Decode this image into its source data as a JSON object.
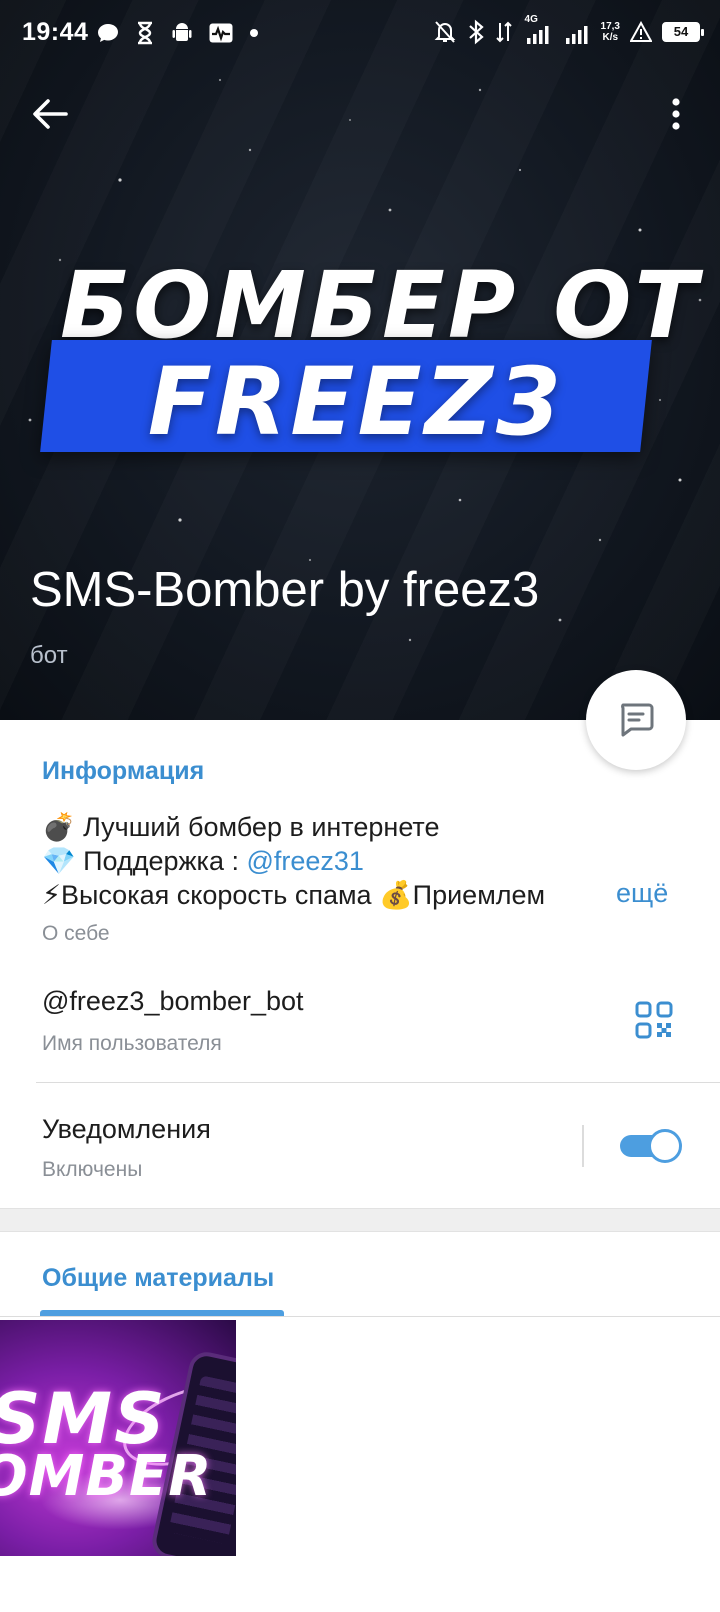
{
  "status_bar": {
    "time": "19:44",
    "network_label": "4G",
    "speed_value": "17,3",
    "speed_unit": "K/s",
    "battery": "54"
  },
  "header": {
    "banner_line1": "БОМБЕР ОТ",
    "banner_line2": "FREEZ3",
    "name": "SMS-Bomber by freez3",
    "subtitle": "бот"
  },
  "info": {
    "section_title": "Информация",
    "bio_line1": "💣 Лучший бомбер в интернете",
    "bio_line2_prefix": "💎 Поддержка : ",
    "bio_line2_link": "@freez31",
    "bio_line3": "⚡Высокая скорость спама 💰Приемлем",
    "more_label": "ещё",
    "about_label": "О себе",
    "username": "@freez3_bomber_bot",
    "username_label": "Имя пользователя",
    "notifications_title": "Уведомления",
    "notifications_state": "Включены"
  },
  "media": {
    "tab_label": "Общие материалы",
    "thumb_text_line1": "SMS",
    "thumb_text_line2": "OMBER"
  },
  "colors": {
    "accent": "#3b8ed0",
    "banner_blue": "#1f4fe6",
    "toggle_on": "#4d9ee0"
  }
}
